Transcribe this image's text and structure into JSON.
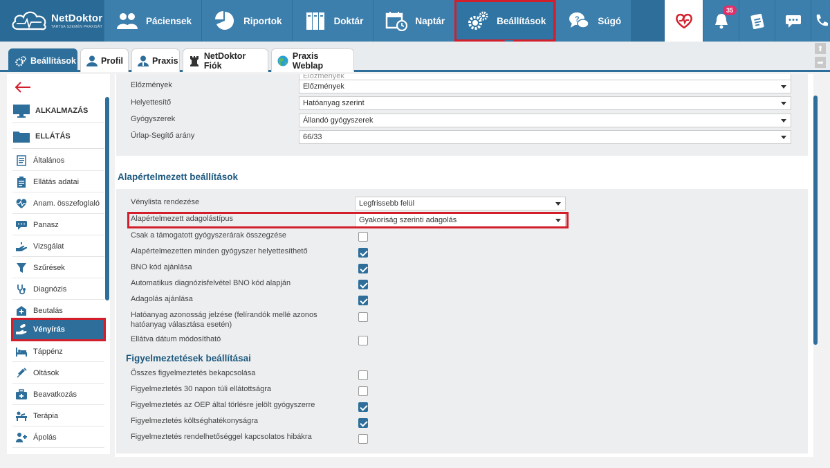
{
  "brand": {
    "name": "NetDoktor",
    "tagline": "TARTSA SZEMÉN PRAXISÁT"
  },
  "nav": [
    {
      "label": "Páciensek",
      "icon": "patients-icon"
    },
    {
      "label": "Riportok",
      "icon": "pie-chart-icon"
    },
    {
      "label": "Doktár",
      "icon": "archive-icon"
    },
    {
      "label": "Naptár",
      "icon": "calendar-icon"
    },
    {
      "label": "Beállítások",
      "icon": "gears-icon",
      "active": true
    },
    {
      "label": "Súgó",
      "icon": "help-chat-icon"
    }
  ],
  "notifications": {
    "count": "35"
  },
  "tabs": [
    {
      "label": "Beállítások",
      "active": true
    },
    {
      "label": "Profil"
    },
    {
      "label": "Praxis"
    },
    {
      "label": "NetDoktor Fiók"
    },
    {
      "label": "Praxis Weblap"
    }
  ],
  "sidebar": {
    "groups": [
      {
        "label": "ALKALMAZÁS"
      },
      {
        "label": "ELLÁTÁS"
      }
    ],
    "items": [
      {
        "label": "Általános"
      },
      {
        "label": "Ellátás adatai"
      },
      {
        "label": "Anam. összefoglaló"
      },
      {
        "label": "Panasz"
      },
      {
        "label": "Vizsgálat"
      },
      {
        "label": "Szűrések"
      },
      {
        "label": "Diagnózis"
      },
      {
        "label": "Beutalás"
      },
      {
        "label": "Vényírás",
        "active": true
      },
      {
        "label": "Táppénz"
      },
      {
        "label": "Oltások"
      },
      {
        "label": "Beavatkozás"
      },
      {
        "label": "Terápia"
      },
      {
        "label": "Ápolás"
      }
    ]
  },
  "top_form": {
    "rows": [
      {
        "label": "Előzmények",
        "value": "Előzmények"
      },
      {
        "label": "Helyettesítő",
        "value": "Hatóanyag szerint"
      },
      {
        "label": "Gyógyszerek",
        "value": "Állandó gyógyszerek"
      },
      {
        "label": "Űrlap-Segítő arány",
        "value": "66/33"
      }
    ],
    "partial_value": "Előzmények"
  },
  "defaults": {
    "title": "Alapértelmezett beállítások",
    "sort_label": "Vénylista rendezése",
    "sort_value": "Legfrissebb felül",
    "dosing_label": "Alapértelmezett adagolástípus",
    "dosing_value": "Gyakoriság szerinti adagolás",
    "checks": [
      {
        "label": "Csak a támogatott gyógyszerárak összegzése",
        "checked": false
      },
      {
        "label": "Alapértelmezetten minden gyógyszer helyettesíthető",
        "checked": true
      },
      {
        "label": "BNO kód ajánlása",
        "checked": true
      },
      {
        "label": "Automatikus diagnózisfelvétel BNO kód alapján",
        "checked": true
      },
      {
        "label": "Adagolás ajánlása",
        "checked": true
      },
      {
        "label": "Hatóanyag azonosság jelzése (felírandók mellé azonos",
        "label2": "hatóanyag választása esetén)",
        "checked": false
      },
      {
        "label": "Ellátva dátum módosítható",
        "checked": false
      }
    ]
  },
  "warnings": {
    "title": "Figyelmeztetések beállításai",
    "checks": [
      {
        "label": "Összes figyelmeztetés bekapcsolása",
        "checked": false
      },
      {
        "label": "Figyelmeztetés 30 napon túli ellátottságra",
        "checked": false
      },
      {
        "label": "Figyelmeztetés az OEP által törlésre jelölt gyógyszerre",
        "checked": true
      },
      {
        "label": "Figyelmeztetés költséghatékonyságra",
        "checked": true
      },
      {
        "label": "Figyelmeztetés rendelhetőséggel kapcsolatos hibákra",
        "checked": false
      }
    ]
  },
  "colors": {
    "primary": "#2d6e9b",
    "highlight": "#d21f2b",
    "badge": "#e0306a"
  }
}
